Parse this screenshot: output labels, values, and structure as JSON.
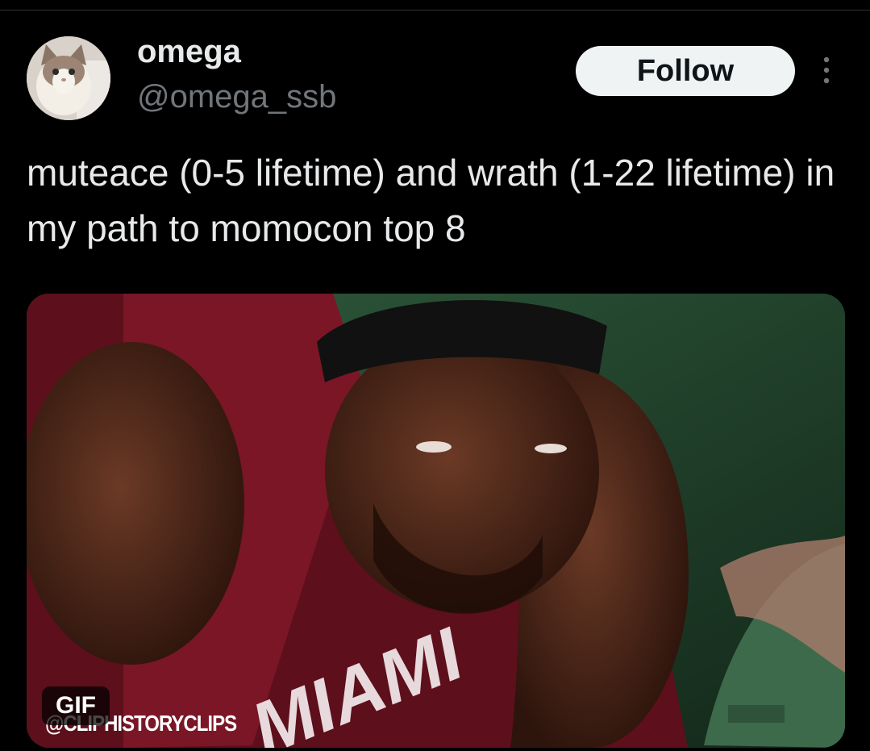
{
  "author": {
    "display_name": "omega",
    "handle": "@omega_ssb",
    "avatar_icon": "cat-avatar"
  },
  "actions": {
    "follow_label": "Follow",
    "more_icon": "more-vertical-icon"
  },
  "tweet": {
    "text": "muteace (0-5 lifetime) and wrath (1-22 lifetime) in my path to momocon top 8"
  },
  "media": {
    "type": "gif",
    "badge_label": "GIF",
    "jersey_text": "MIAMI",
    "watermark_text": "@CLIPHISTORYCLIPS"
  },
  "colors": {
    "background": "#000000",
    "primary_text": "#e7e9ea",
    "secondary_text": "#71767b",
    "follow_button_bg": "#eff3f4",
    "follow_button_text": "#0f1419"
  }
}
